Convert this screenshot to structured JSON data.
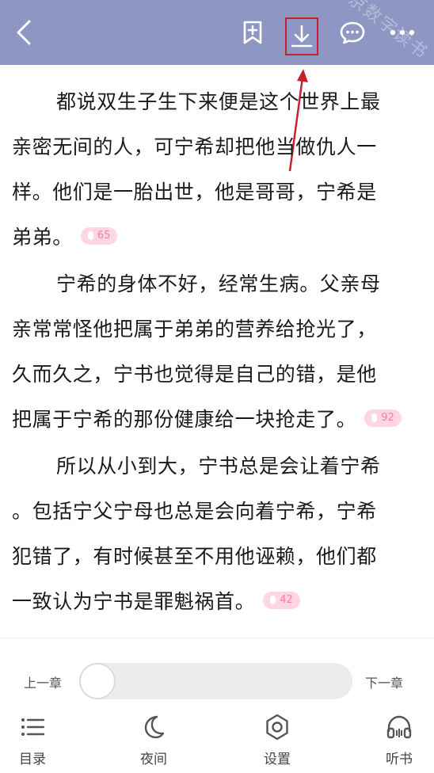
{
  "topbar": {
    "background": "#8e96c3",
    "icons": [
      "back-icon",
      "add-bookmark-icon",
      "download-icon",
      "comment-icon",
      "more-icon"
    ],
    "watermark": "北京数字读书"
  },
  "annotation": {
    "highlight_color": "#c8202a"
  },
  "paragraphs": [
    {
      "lines": [
        "都说双生子生下来便是这个世界上最",
        "亲密无间的人，可宁希却把他当做仇人一",
        "样。他们是一胎出世，他是哥哥，宁希是",
        "弟弟。"
      ],
      "comment_count": "65"
    },
    {
      "lines": [
        "宁希的身体不好，经常生病。父亲母",
        "亲常常怪他把属于弟弟的营养给抢光了，",
        "久而久之，宁书也觉得是自己的错，是他",
        "把属于宁希的那份健康给一块抢走了。"
      ],
      "comment_count": "92"
    },
    {
      "lines": [
        "所以从小到大，宁书总是会让着宁希",
        "。包括宁父宁母也总是会向着宁希，宁希",
        "犯错了，有时候甚至不用他诬赖，他们都",
        "一致认为宁书是罪魁祸首。"
      ],
      "comment_count": "42"
    }
  ],
  "bottom": {
    "prev_chapter": "上一章",
    "next_chapter": "下一章",
    "progress_fraction": 0.0,
    "nav": [
      {
        "label": "目录",
        "icon": "catalog-icon"
      },
      {
        "label": "夜间",
        "icon": "moon-icon"
      },
      {
        "label": "设置",
        "icon": "gear-icon"
      },
      {
        "label": "听书",
        "icon": "headphones-icon"
      }
    ]
  }
}
